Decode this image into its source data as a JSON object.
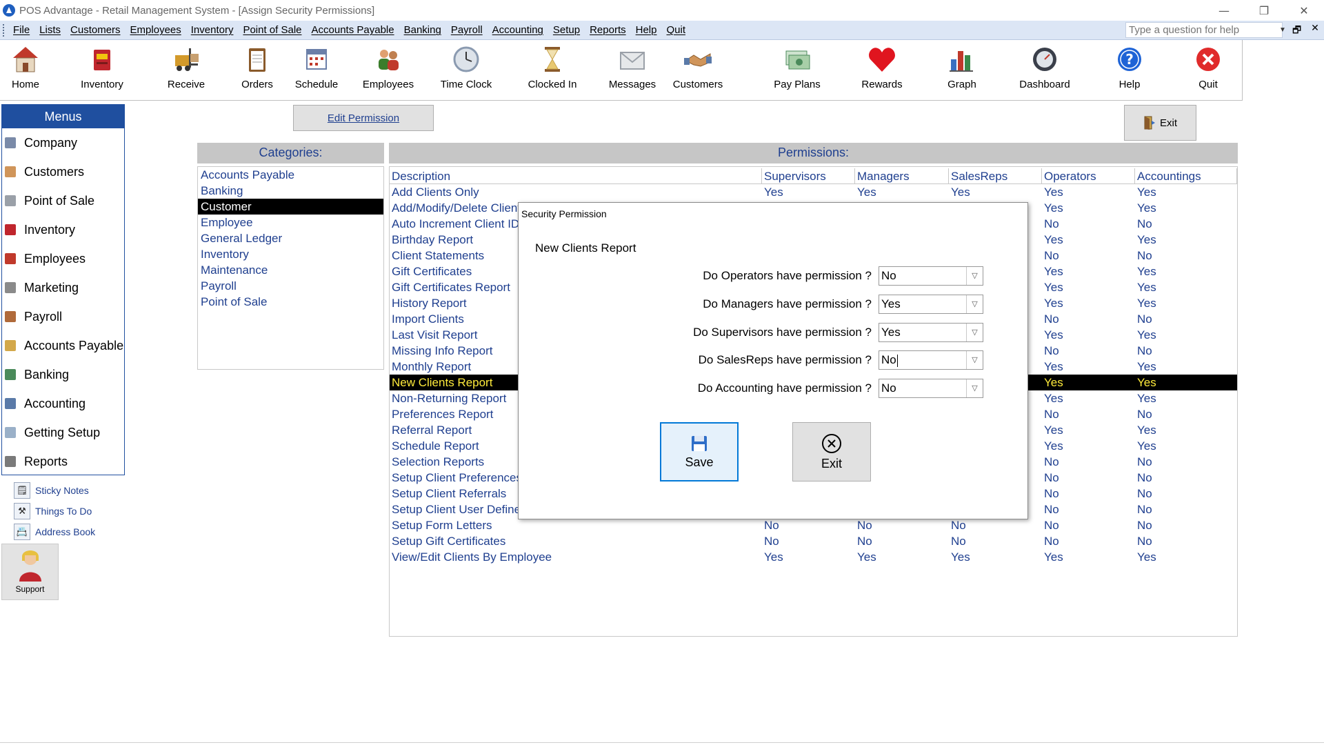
{
  "window": {
    "title": "POS Advantage - Retail Management System - [Assign Security Permissions]",
    "controls": [
      "—",
      "❐",
      "✕"
    ]
  },
  "menubar": {
    "items": [
      "File",
      "Lists",
      "Customers",
      "Employees",
      "Inventory",
      "Point of Sale",
      "Accounts Payable",
      "Banking",
      "Payroll",
      "Accounting",
      "Setup",
      "Reports",
      "Help",
      "Quit"
    ],
    "help_placeholder": "Type a question for help"
  },
  "toolbar": {
    "items": [
      {
        "label": "Home",
        "icon": "house-icon",
        "color": "#c0392b"
      },
      {
        "label": "Inventory",
        "icon": "box-icon",
        "color": "#c0262d"
      },
      {
        "label": "Receive",
        "icon": "forklift-icon",
        "color": "#d39a2b"
      },
      {
        "label": "Orders",
        "icon": "clipboard-icon",
        "color": "#8a5a2b"
      },
      {
        "label": "Schedule",
        "icon": "calendar-icon",
        "color": "#6b7fa8"
      },
      {
        "label": "Employees",
        "icon": "people-icon",
        "color": "#3a7d2b"
      },
      {
        "label": "Time Clock",
        "icon": "clock-icon",
        "color": "#8a9ab0"
      },
      {
        "label": "Clocked In",
        "icon": "hourglass-icon",
        "color": "#c8a24a"
      },
      {
        "label": "Messages",
        "icon": "envelope-icon",
        "color": "#9aa0a8"
      },
      {
        "label": "Customers",
        "icon": "handshake-icon",
        "color": "#d0955a"
      },
      {
        "label": "Pay Plans",
        "icon": "money-icon",
        "color": "#4a8a5a"
      },
      {
        "label": "Rewards",
        "icon": "heart-icon",
        "color": "#e0151f"
      },
      {
        "label": "Graph",
        "icon": "bar-chart-icon",
        "color": "#3a6fc0"
      },
      {
        "label": "Dashboard",
        "icon": "gauge-icon",
        "color": "#3a3f4a"
      },
      {
        "label": "Help",
        "icon": "help-icon",
        "color": "#1e63d6"
      },
      {
        "label": "Quit",
        "icon": "quit-icon",
        "color": "#e02b2b"
      }
    ]
  },
  "sidebar": {
    "header": "Menus",
    "items": [
      {
        "label": "Company",
        "color": "#7a8aa8"
      },
      {
        "label": "Customers",
        "color": "#d0955a"
      },
      {
        "label": "Point of Sale",
        "color": "#9aa0a8"
      },
      {
        "label": "Inventory",
        "color": "#c0262d"
      },
      {
        "label": "Employees",
        "color": "#c0392b"
      },
      {
        "label": "Marketing",
        "color": "#8a8a8a"
      },
      {
        "label": "Payroll",
        "color": "#b06a3a"
      },
      {
        "label": "Accounts Payable",
        "color": "#d3a84a"
      },
      {
        "label": "Banking",
        "color": "#4a8a5a"
      },
      {
        "label": "Accounting",
        "color": "#5a7aa8"
      },
      {
        "label": "Getting Setup",
        "color": "#9ab0c8"
      },
      {
        "label": "Reports",
        "color": "#7a7a7a"
      }
    ],
    "quick_links": [
      {
        "label": "Sticky Notes",
        "icon": "sticky-note-icon"
      },
      {
        "label": "Things To Do",
        "icon": "hammer-icon"
      },
      {
        "label": "Address Book",
        "icon": "address-book-icon"
      }
    ],
    "support_label": "Support"
  },
  "main": {
    "edit_permission_label": "Edit Permission",
    "exit_label": "Exit",
    "categories_header": "Categories:",
    "categories": [
      "Accounts Payable",
      "Banking",
      "Customer",
      "Employee",
      "General Ledger",
      "Inventory",
      "Maintenance",
      "Payroll",
      "Point of Sale"
    ],
    "selected_category": "Customer",
    "permissions_header": "Permissions:",
    "columns": [
      "Description",
      "Supervisors",
      "Managers",
      "SalesReps",
      "Operators",
      "Accountings"
    ],
    "rows": [
      [
        "Add Clients Only",
        "Yes",
        "Yes",
        "Yes",
        "Yes",
        "Yes"
      ],
      [
        "Add/Modify/Delete Clients",
        "",
        "",
        "",
        "Yes",
        "Yes"
      ],
      [
        "Auto Increment Client ID",
        "",
        "",
        "",
        "No",
        "No"
      ],
      [
        "Birthday Report",
        "",
        "",
        "",
        "Yes",
        "Yes"
      ],
      [
        "Client Statements",
        "",
        "",
        "",
        "No",
        "No"
      ],
      [
        "Gift Certificates",
        "",
        "",
        "",
        "Yes",
        "Yes"
      ],
      [
        "Gift Certificates Report",
        "",
        "",
        "",
        "Yes",
        "Yes"
      ],
      [
        "History Report",
        "",
        "",
        "",
        "Yes",
        "Yes"
      ],
      [
        "Import Clients",
        "",
        "",
        "",
        "No",
        "No"
      ],
      [
        "Last Visit Report",
        "",
        "",
        "",
        "Yes",
        "Yes"
      ],
      [
        "Missing Info Report",
        "",
        "",
        "",
        "No",
        "No"
      ],
      [
        "Monthly Report",
        "",
        "",
        "",
        "Yes",
        "Yes"
      ],
      [
        "New Clients Report",
        "",
        "",
        "",
        "Yes",
        "Yes"
      ],
      [
        "Non-Returning Report",
        "",
        "",
        "",
        "Yes",
        "Yes"
      ],
      [
        "Preferences Report",
        "",
        "",
        "",
        "No",
        "No"
      ],
      [
        "Referral Report",
        "",
        "",
        "",
        "Yes",
        "Yes"
      ],
      [
        "Schedule Report",
        "",
        "",
        "",
        "Yes",
        "Yes"
      ],
      [
        "Selection Reports",
        "",
        "",
        "",
        "No",
        "No"
      ],
      [
        "Setup Client Preferences",
        "",
        "",
        "",
        "No",
        "No"
      ],
      [
        "Setup Client Referrals",
        "",
        "",
        "",
        "No",
        "No"
      ],
      [
        "Setup Client User Defined",
        "",
        "",
        "",
        "No",
        "No"
      ],
      [
        "Setup Form Letters",
        "No",
        "No",
        "No",
        "No",
        "No"
      ],
      [
        "Setup Gift Certificates",
        "No",
        "No",
        "No",
        "No",
        "No"
      ],
      [
        "View/Edit Clients By Employee",
        "Yes",
        "Yes",
        "Yes",
        "Yes",
        "Yes"
      ]
    ],
    "selected_row_index": 12
  },
  "dialog": {
    "title": "Security Permission",
    "subtitle": "New Clients Report",
    "questions": [
      {
        "label": "Do Operators have permission ?",
        "value": "No"
      },
      {
        "label": "Do Managers have permission ?",
        "value": "Yes"
      },
      {
        "label": "Do Supervisors have permission ?",
        "value": "Yes"
      },
      {
        "label": "Do SalesReps have permission ?",
        "value": "No"
      },
      {
        "label": "Do Accounting have permission ?",
        "value": "No"
      }
    ],
    "save_label": "Save",
    "exit_label": "Exit"
  }
}
